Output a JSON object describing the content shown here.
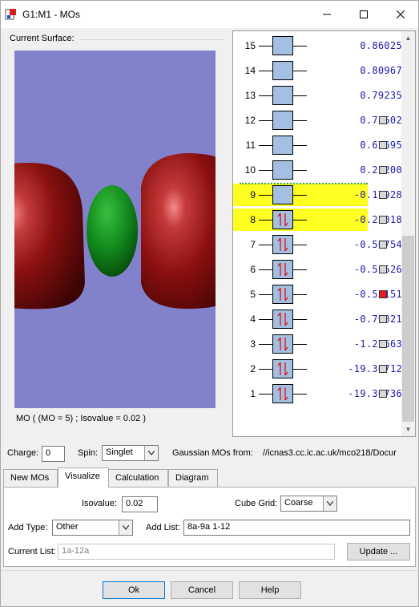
{
  "window": {
    "title": "G1:M1 - MOs",
    "icon": "gaussview-app-icon"
  },
  "surface": {
    "group_label": "Current Surface:",
    "caption": "MO ( (MO = 5) ; Isovalue = 0.02 )",
    "background_color": "#8282cc",
    "lobe_positive_color": "#7a0d0d",
    "lobe_negative_color": "#0f7a1a"
  },
  "orbitals": [
    {
      "num": "15",
      "energy": "0.86025",
      "occupied": false,
      "highlight": false,
      "checkbox": null
    },
    {
      "num": "14",
      "energy": "0.80967",
      "occupied": false,
      "highlight": false,
      "checkbox": null
    },
    {
      "num": "13",
      "energy": "0.79235",
      "occupied": false,
      "highlight": false,
      "checkbox": null
    },
    {
      "num": "12",
      "energy": "0.71502",
      "occupied": false,
      "highlight": false,
      "checkbox": "off"
    },
    {
      "num": "11",
      "energy": "0.67695",
      "occupied": false,
      "highlight": false,
      "checkbox": "off"
    },
    {
      "num": "10",
      "energy": "0.21200",
      "occupied": false,
      "highlight": false,
      "checkbox": "off"
    },
    {
      "num": "9",
      "energy": "-0.17928",
      "occupied": false,
      "highlight": true,
      "checkbox": "off"
    },
    {
      "num": "8",
      "energy": "-0.25018",
      "occupied": true,
      "highlight": true,
      "checkbox": "off"
    },
    {
      "num": "7",
      "energy": "-0.50754",
      "occupied": true,
      "highlight": false,
      "checkbox": "off"
    },
    {
      "num": "6",
      "energy": "-0.51526",
      "occupied": true,
      "highlight": false,
      "checkbox": "off"
    },
    {
      "num": "5",
      "energy": "-0.53151",
      "occupied": true,
      "highlight": false,
      "checkbox": "on"
    },
    {
      "num": "4",
      "energy": "-0.79821",
      "occupied": true,
      "highlight": false,
      "checkbox": "off"
    },
    {
      "num": "3",
      "energy": "-1.27663",
      "occupied": true,
      "highlight": false,
      "checkbox": "off"
    },
    {
      "num": "2",
      "energy": "-19.30712",
      "occupied": true,
      "highlight": false,
      "checkbox": "off"
    },
    {
      "num": "1",
      "energy": "-19.30736",
      "occupied": true,
      "highlight": false,
      "checkbox": "off"
    }
  ],
  "charge": {
    "label": "Charge:",
    "value": "0"
  },
  "spin": {
    "label": "Spin:",
    "value": "Singlet"
  },
  "source": {
    "label": "Gaussian MOs from:",
    "value": "//icnas3.cc.ic.ac.uk/mco218/Docur"
  },
  "tabs": [
    {
      "label": "New MOs",
      "active": false
    },
    {
      "label": "Visualize",
      "active": true
    },
    {
      "label": "Calculation",
      "active": false
    },
    {
      "label": "Diagram",
      "active": false
    }
  ],
  "visualize": {
    "isovalue_label": "Isovalue:",
    "isovalue": "0.02",
    "cube_grid_label": "Cube Grid:",
    "cube_grid": "Coarse",
    "add_type_label": "Add Type:",
    "add_type": "Other",
    "add_list_label": "Add List:",
    "add_list": "8a-9a 1-12",
    "current_list_label": "Current List:",
    "current_list": "1a-12a",
    "update_label": "Update ..."
  },
  "buttons": {
    "ok": "Ok",
    "cancel": "Cancel",
    "help": "Help"
  },
  "colors": {
    "homo_lumo_highlight": "#ffff22",
    "energy_text": "#1c1ca8",
    "selected_checkbox": "#e81818",
    "orbital_fill": "#a3c0e2"
  }
}
